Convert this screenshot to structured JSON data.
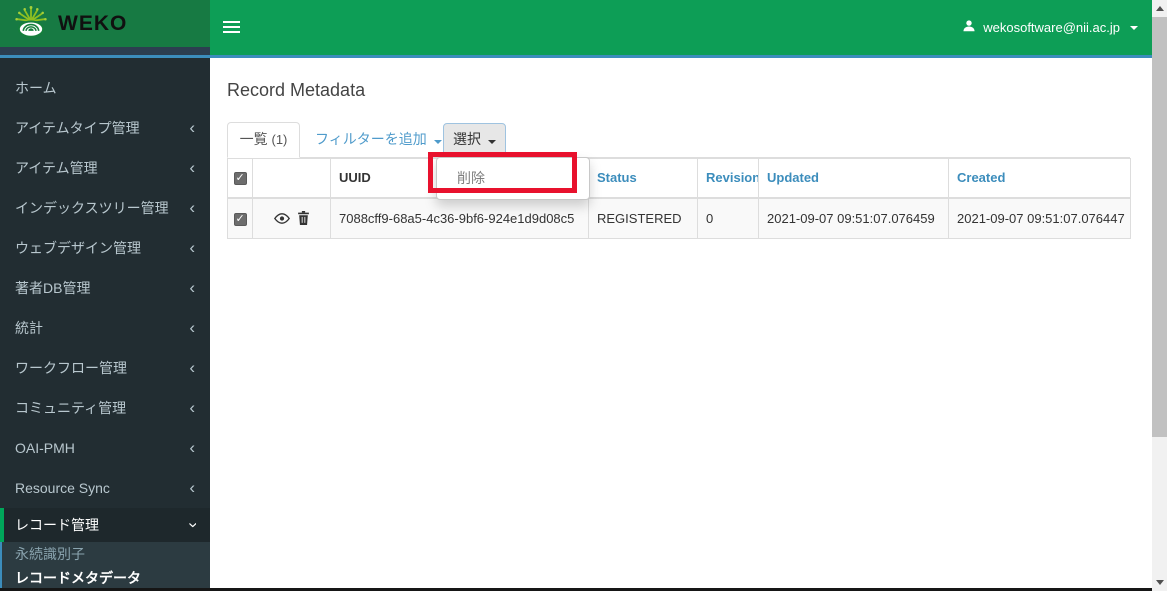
{
  "header": {
    "brand": "WEKO",
    "user_email": "wekosoftware@nii.ac.jp"
  },
  "sidebar": {
    "items": [
      {
        "label": "ホーム"
      },
      {
        "label": "アイテムタイプ管理"
      },
      {
        "label": "アイテム管理"
      },
      {
        "label": "インデックスツリー管理"
      },
      {
        "label": "ウェブデザイン管理"
      },
      {
        "label": "著者DB管理"
      },
      {
        "label": "統計"
      },
      {
        "label": "ワークフロー管理"
      },
      {
        "label": "コミュニティ管理"
      },
      {
        "label": "OAI-PMH"
      },
      {
        "label": "Resource Sync"
      },
      {
        "label": "レコード管理"
      }
    ],
    "submenu": [
      {
        "label": "永続識別子"
      },
      {
        "label": "レコードメタデータ"
      }
    ]
  },
  "main": {
    "title": "Record Metadata",
    "tabs": {
      "list_label": "一覧",
      "list_count": "(1)",
      "filter_label": "フィルターを追加",
      "select_label": "選択"
    },
    "dropdown": {
      "delete_label": "削除"
    },
    "table": {
      "headers": {
        "uuid": "UUID",
        "status": "Status",
        "revision": "Revision",
        "updated": "Updated",
        "created": "Created"
      },
      "rows": [
        {
          "uuid": "7088cff9-68a5-4c36-9bf6-924e1d9d08c5",
          "status": "REGISTERED",
          "revision": "0",
          "updated": "2021-09-07 09:51:07.076459",
          "created": "2021-09-07 09:51:07.076447",
          "checked": true
        }
      ]
    }
  },
  "colors": {
    "brand_green": "#0d9e56",
    "logo_green": "#177a43",
    "sidebar_dark": "#222d32",
    "accent_blue": "#3c8dbc",
    "active_green": "#00a65a",
    "annotation_red": "#e8112d"
  }
}
